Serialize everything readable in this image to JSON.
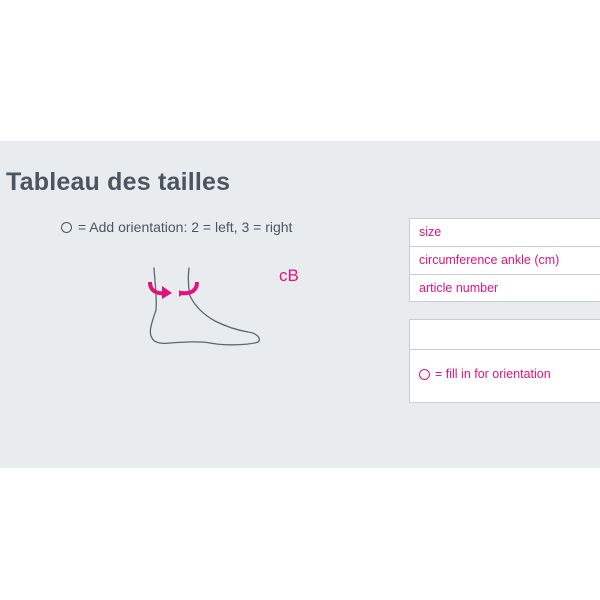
{
  "title": "Tableau des tailles",
  "orientation_legend": "= Add orientation: 2 = left, 3 = right",
  "measure_label": "cB",
  "size_table": {
    "rows": [
      "size",
      "circumference ankle (cm)",
      "article number"
    ]
  },
  "order_box": {
    "note": "= fill in for orientation"
  },
  "colors": {
    "accent": "#e0137a",
    "text": "#4a5560",
    "panel_bg": "#e9ecee"
  },
  "icons": [
    "circle-icon",
    "foot-illustration",
    "measure-arrow-icon"
  ]
}
